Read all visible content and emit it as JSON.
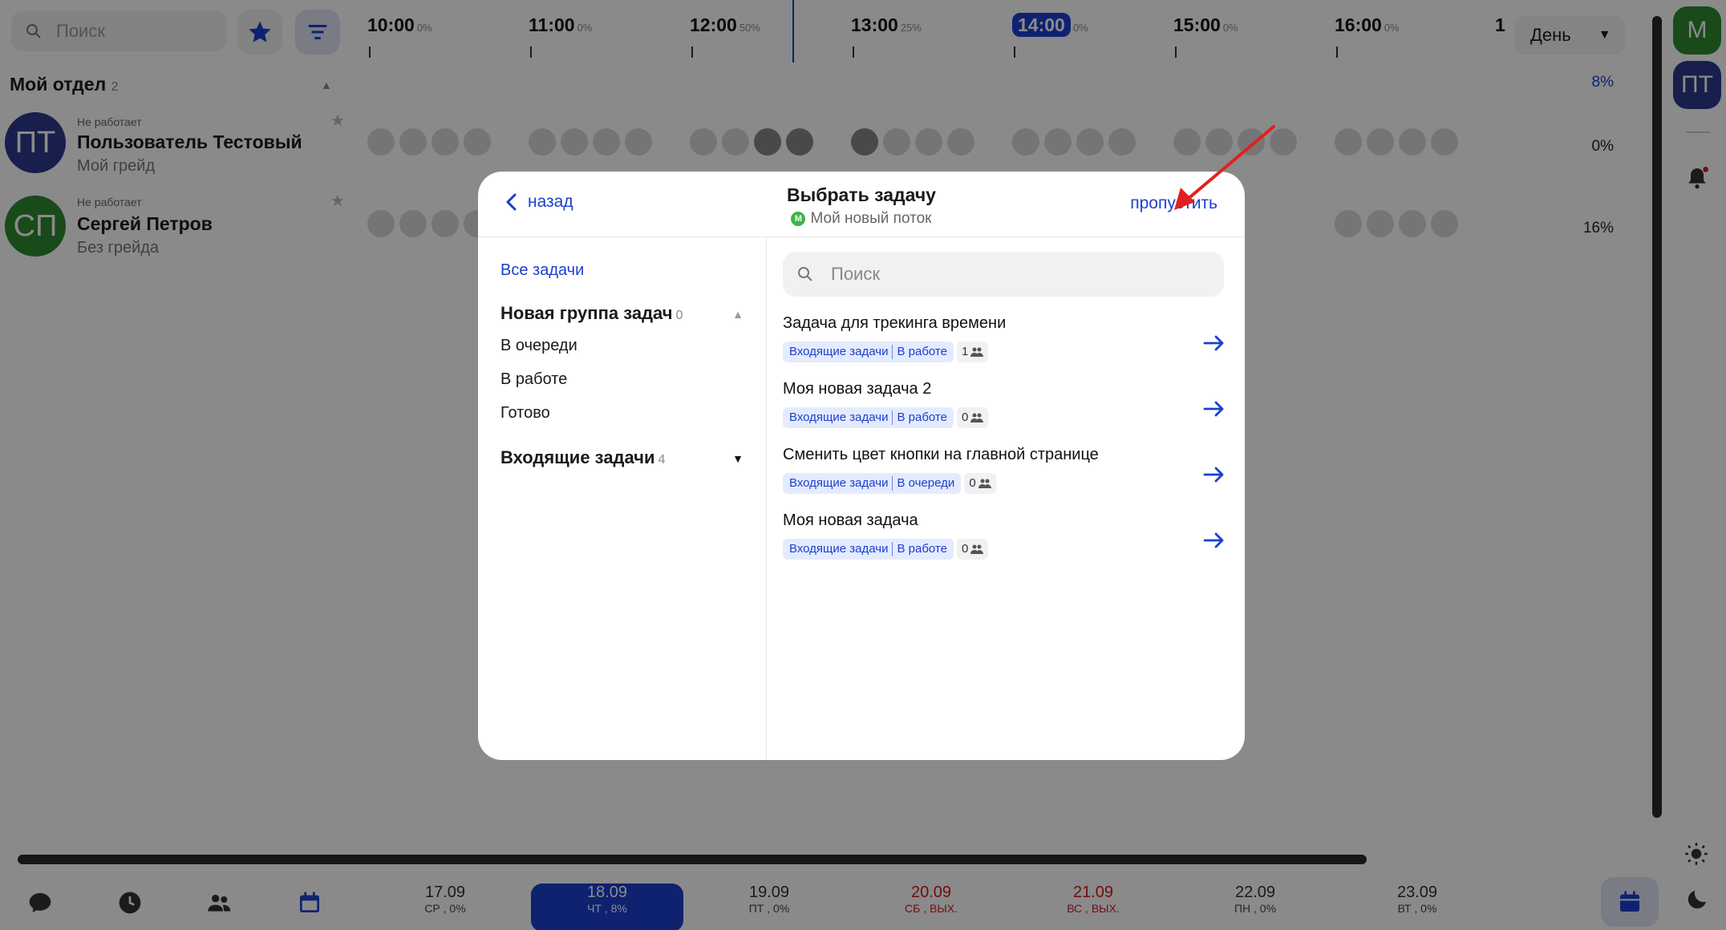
{
  "background": {
    "search_placeholder": "Поиск",
    "timeline": [
      {
        "time": "10:00",
        "pct": "0%"
      },
      {
        "time": "11:00",
        "pct": "0%"
      },
      {
        "time": "12:00",
        "pct": "50%"
      },
      {
        "time": "13:00",
        "pct": "25%"
      },
      {
        "time": "14:00",
        "pct": "0%",
        "current": true
      },
      {
        "time": "15:00",
        "pct": "0%"
      },
      {
        "time": "16:00",
        "pct": "0%"
      },
      {
        "time": "1",
        "pct": ""
      }
    ],
    "view_select": "День",
    "department": {
      "name": "Мой отдел",
      "count": "2",
      "pct": "8%"
    },
    "users": [
      {
        "initials": "ПТ",
        "status": "Не работает",
        "name": "Пользователь Тестовый",
        "grade": "Мой грейд",
        "pct": "0%",
        "color": "#2d3a8c"
      },
      {
        "initials": "СП",
        "status": "Не работает",
        "name": "Сергей Петров",
        "grade": "Без грейда",
        "pct": "16%",
        "color": "#2f8a2f"
      }
    ],
    "dates": [
      {
        "date": "17.09",
        "week": "СР , 0%",
        "type": "normal"
      },
      {
        "date": "18.09",
        "week": "ЧТ , 8%",
        "type": "active"
      },
      {
        "date": "19.09",
        "week": "ПТ , 0%",
        "type": "normal"
      },
      {
        "date": "20.09",
        "week": "СБ , ВЫХ.",
        "type": "weekend"
      },
      {
        "date": "21.09",
        "week": "ВС , ВЫХ.",
        "type": "weekend"
      },
      {
        "date": "22.09",
        "week": "ПН , 0%",
        "type": "normal"
      },
      {
        "date": "23.09",
        "week": "ВТ , 0%",
        "type": "normal"
      }
    ],
    "rail": [
      {
        "initials": "М",
        "color": "#2f8a2f"
      },
      {
        "initials": "ПТ",
        "color": "#2d3a8c"
      }
    ]
  },
  "modal": {
    "back_label": "назад",
    "title": "Выбрать задачу",
    "subtitle": "Мой новый поток",
    "subtitle_badge": "М",
    "skip_label": "пропустить",
    "all_tasks_label": "Все задачи",
    "groups": [
      {
        "name": "Новая группа задач",
        "count": "0",
        "expanded": true,
        "items": [
          "В очереди",
          "В работе",
          "Готово"
        ]
      },
      {
        "name": "Входящие задачи",
        "count": "4",
        "expanded": false,
        "items": []
      }
    ],
    "search_placeholder": "Поиск",
    "tasks": [
      {
        "title": "Задача для трекинга времени",
        "group": "Входящие задачи",
        "status": "В работе",
        "count": "1"
      },
      {
        "title": "Моя новая задача 2",
        "group": "Входящие задачи",
        "status": "В работе",
        "count": "0"
      },
      {
        "title": "Сменить цвет кнопки на главной странице",
        "group": "Входящие задачи",
        "status": "В очереди",
        "count": "0"
      },
      {
        "title": "Моя новая задача",
        "group": "Входящие задачи",
        "status": "В работе",
        "count": "0"
      }
    ]
  },
  "colors": {
    "accent": "#1b3fcf",
    "weekend": "#d31a1a",
    "annotation_arrow": "#e02020"
  }
}
